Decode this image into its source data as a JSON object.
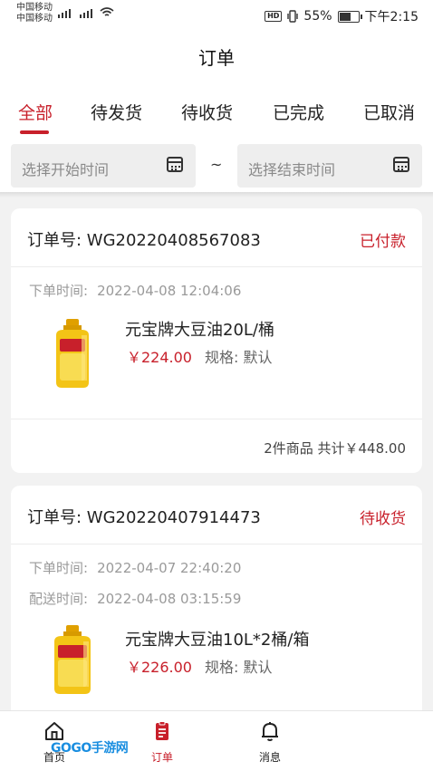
{
  "status_bar": {
    "carrier1": "中国移动",
    "carrier2": "中国移动",
    "battery": "55%",
    "time": "下午2:15"
  },
  "header": {
    "title": "订单"
  },
  "tabs": [
    {
      "label": "全部",
      "active": true
    },
    {
      "label": "待发货"
    },
    {
      "label": "待收货"
    },
    {
      "label": "已完成"
    },
    {
      "label": "已取消"
    }
  ],
  "date_filter": {
    "start_placeholder": "选择开始时间",
    "separator": "~",
    "end_placeholder": "选择结束时间"
  },
  "orders": [
    {
      "order_no": "订单号:  WG20220408567083",
      "status": "已付款",
      "order_time_label": "下单时间:",
      "order_time": "2022-04-08 12:04:06",
      "product_name": "元宝牌大豆油20L/桶",
      "price": "￥224.00",
      "spec": "规格:  默认",
      "summary": "2件商品  共计￥448.00"
    },
    {
      "order_no": "订单号:  WG20220407914473",
      "status": "待收货",
      "order_time_label": "下单时间:",
      "order_time": "2022-04-07 22:40:20",
      "delivery_time_label": "配送时间:",
      "delivery_time": "2022-04-08 03:15:59",
      "product_name": "元宝牌大豆油10L*2桶/箱",
      "price": "￥226.00",
      "spec": "规格:  默认"
    }
  ],
  "bottom_nav": [
    {
      "label": "首页",
      "icon": "home-icon"
    },
    {
      "label": "订单",
      "icon": "order-icon",
      "active": true
    },
    {
      "label": "消息",
      "icon": "bell-icon"
    }
  ],
  "watermark": "GOGO手游网",
  "colors": {
    "accent": "#c8202b"
  }
}
